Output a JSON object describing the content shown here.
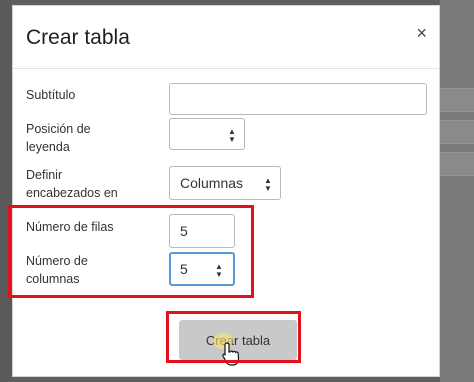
{
  "dialog": {
    "title": "Crear tabla",
    "close_glyph": "×"
  },
  "form": {
    "subtitle_label": "Subtítulo",
    "subtitle_value": "",
    "caption_position_label_line1": "Posición de",
    "caption_position_label_line2": "leyenda",
    "caption_position_value": "",
    "headers_label_line1": "Definir",
    "headers_label_line2": "encabezados en",
    "headers_value": "Columnas",
    "rows_label": "Número de filas",
    "rows_value": "5",
    "columns_label_line1": "Número de",
    "columns_label_line2": "columnas",
    "columns_value": "5"
  },
  "actions": {
    "submit_label": "Crear tabla"
  },
  "icons": {
    "close": "close-icon",
    "select_arrows": "updown-arrows-icon",
    "cursor": "hand-pointer-icon"
  },
  "colors": {
    "highlight": "#e0121a",
    "button_bg": "#c9c9c9"
  }
}
